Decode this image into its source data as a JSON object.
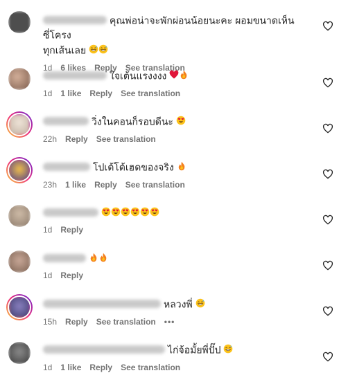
{
  "comments": [
    {
      "text": "คุณพ่อน่าจะพักผ่อนน้อยนะคะ ผอมขนาดเห็นซี่โครงทุกเส้นเลย",
      "text_line1": "คุณพ่อน่าจะพักผ่อนน้อยนะคะ ผอมขนาดเห็นซี่โครง",
      "text_line2": "ทุกเส้นเลย",
      "emojis": [
        "grin-sweat-emoji",
        "grin-sweat-emoji"
      ],
      "time": "1d",
      "likes": "6 likes",
      "reply": "Reply",
      "translation": "See translation",
      "avatar_color": "#5a5a5a"
    },
    {
      "text": "ใจเต้นแรงงงง",
      "emojis": [
        "red-heart-emoji",
        "fire-emoji"
      ],
      "time": "1d",
      "likes": "1 like",
      "reply": "Reply",
      "translation": "See translation",
      "avatar_color": "#a08070"
    },
    {
      "text": "วิ่งในคอนก็รอบดีนะ",
      "emojis": [
        "heart-eyes-emoji"
      ],
      "time": "22h",
      "reply": "Reply",
      "translation": "See translation",
      "avatar_color": "#d9cfc4"
    },
    {
      "text": "โปเต้โต้เฮดของจริง",
      "emojis": [
        "fire-emoji"
      ],
      "time": "23h",
      "likes": "1 like",
      "reply": "Reply",
      "translation": "See translation",
      "avatar_color": "#8a6a2a"
    },
    {
      "text": "",
      "emojis": [
        "heart-eyes-emoji",
        "heart-eyes-emoji",
        "heart-eyes-emoji",
        "heart-eyes-emoji",
        "heart-eyes-emoji",
        "heart-eyes-emoji"
      ],
      "time": "1d",
      "reply": "Reply",
      "avatar_color": "#b0a090"
    },
    {
      "text": "",
      "emojis": [
        "fire-emoji",
        "fire-emoji"
      ],
      "time": "1d",
      "reply": "Reply",
      "avatar_color": "#9a8070"
    },
    {
      "text": "หลวงพี่",
      "emojis": [
        "grin-sweat-emoji"
      ],
      "time": "15h",
      "reply": "Reply",
      "translation": "See translation",
      "more": "•••",
      "avatar_color": "#5a5a8a"
    },
    {
      "text": "ไก่จ้อมั้ยพี่ปั๊ป",
      "emojis": [
        "grin-sweat-emoji"
      ],
      "time": "1d",
      "likes": "1 like",
      "reply": "Reply",
      "translation": "See translation",
      "avatar_color": "#6a6a6a"
    }
  ],
  "colors": {
    "text": "#262626",
    "meta": "#737373",
    "heart_outline": "#262626",
    "background": "#ffffff"
  }
}
